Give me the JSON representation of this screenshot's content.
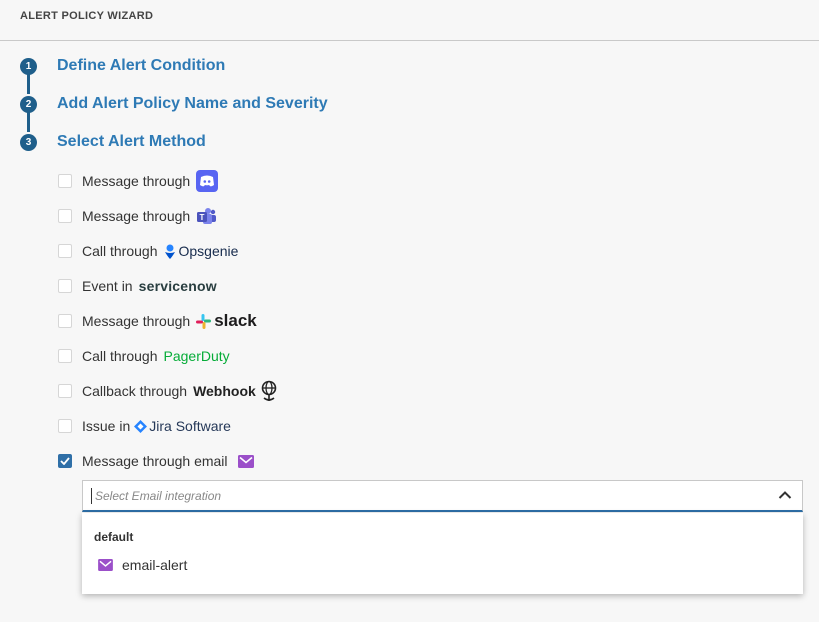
{
  "header": {
    "title": "ALERT POLICY WIZARD"
  },
  "steps": [
    {
      "number": "1",
      "label": "Define Alert Condition"
    },
    {
      "number": "2",
      "label": "Add Alert Policy Name and Severity"
    },
    {
      "number": "3",
      "label": "Select Alert Method"
    }
  ],
  "options": [
    {
      "text": "Message through",
      "brand": "",
      "icon": "discord-icon",
      "checked": false
    },
    {
      "text": "Message through",
      "brand": "",
      "icon": "teams-icon",
      "checked": false
    },
    {
      "text": "Call through",
      "brand": "Opsgenie",
      "icon": "opsgenie-icon",
      "checked": false
    },
    {
      "text": "Event in",
      "brand": "servicenow",
      "icon": "",
      "checked": false
    },
    {
      "text": "Message through",
      "brand": "slack",
      "icon": "slack-icon",
      "checked": false
    },
    {
      "text": "Call through",
      "brand": "PagerDuty",
      "icon": "",
      "checked": false
    },
    {
      "text": "Callback through",
      "brand": "Webhook",
      "icon": "webhook-icon",
      "checked": false
    },
    {
      "text": "Issue in",
      "brand": "Jira Software",
      "icon": "jira-icon",
      "checked": false
    },
    {
      "text": "Message through email",
      "brand": "",
      "icon": "email-icon",
      "checked": true
    }
  ],
  "email_select": {
    "placeholder": "Select Email integration",
    "group_label": "default",
    "items": [
      {
        "label": "email-alert",
        "icon": "email-icon"
      }
    ]
  },
  "colors": {
    "step_circle": "#1f5f8b",
    "step_label": "#2e7ab5",
    "checkbox_checked": "#2f6fa7",
    "email_icon": "#9b4fc9",
    "pagerduty": "#06ac38",
    "opsgenie": "#172b4d",
    "jira": "#253858"
  }
}
